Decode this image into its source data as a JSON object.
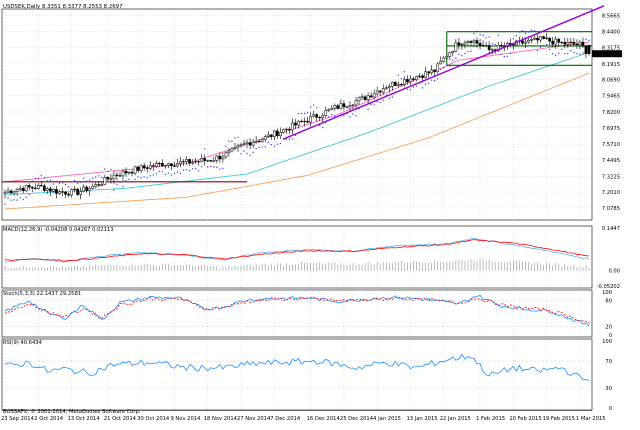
{
  "header": {
    "symbol_line": "USDSEK,Daily  8.3351 8.3377 8.2553 8.2697",
    "copyright": "BOSSAFX, © 2001-2014, MetaQuotes Software Corp."
  },
  "colors": {
    "up_candle": "#ffffff",
    "down_candle": "#000000",
    "trendline": "#9400d3",
    "channel": "#006400",
    "ma_fast": "#ff69b4",
    "ma_mid": "#40c8d8",
    "ma_slow": "#f4a460",
    "sar": "#3c3cff",
    "resistance": "#8b0000",
    "macd_line": "#5ab4f0",
    "macd_signal": "#ff0000",
    "macd_hist": "#a0a0a0",
    "stoch_k": "#1e90ff",
    "stoch_d": "#ff0000",
    "rsi": "#1e90ff"
  },
  "chart_data": [
    {
      "type": "candlestick",
      "pane": "price",
      "title": "USDSEK,Daily  8.3351 8.3377 8.2553 8.2697",
      "symbol": "USDSEK",
      "timeframe": "Daily",
      "last_bar": {
        "open": 8.3351,
        "high": 8.3377,
        "low": 8.2553,
        "close": 8.2697
      },
      "current_price_label": "8.2697",
      "ylim": [
        7.0,
        8.6
      ],
      "y_ticks": [
        "8.5665",
        "8.4400",
        "8.3175",
        "8.1915",
        "8.0690",
        "7.9465",
        "7.8200",
        "7.6975",
        "7.5710",
        "7.4495",
        "7.3225",
        "7.2010",
        "7.0785"
      ],
      "x_ticks": [
        "23 Sep 2014",
        "2 Oct 2014",
        "13 Oct 2014",
        "21 Oct 2014",
        "30 Oct 2014",
        "9 Nov 2014",
        "18 Nov 2014",
        "27 Nov 2014",
        "7 Dec 2014",
        "16 Dec 2014",
        "25 Dec 2014",
        "4 Jan 2015",
        "13 Jan 2015",
        "22 Jan 2015",
        "1 Feb 2015",
        "10 Feb 2015",
        "19 Feb 2015",
        "1 Mar 2015"
      ],
      "close_anchors": [
        [
          0,
          7.2
        ],
        [
          5,
          7.23
        ],
        [
          12,
          7.24
        ],
        [
          18,
          7.2
        ],
        [
          24,
          7.2
        ],
        [
          30,
          7.25
        ],
        [
          36,
          7.33
        ],
        [
          44,
          7.38
        ],
        [
          52,
          7.42
        ],
        [
          60,
          7.43
        ],
        [
          68,
          7.45
        ],
        [
          74,
          7.5
        ],
        [
          80,
          7.58
        ],
        [
          86,
          7.62
        ],
        [
          92,
          7.68
        ],
        [
          100,
          7.76
        ],
        [
          104,
          7.8
        ],
        [
          110,
          7.86
        ],
        [
          118,
          7.92
        ],
        [
          126,
          8.02
        ],
        [
          134,
          8.08
        ],
        [
          142,
          8.14
        ],
        [
          146,
          8.26
        ],
        [
          150,
          8.36
        ],
        [
          154,
          8.38
        ],
        [
          160,
          8.3
        ],
        [
          166,
          8.33
        ],
        [
          172,
          8.36
        ],
        [
          178,
          8.38
        ],
        [
          184,
          8.35
        ],
        [
          190,
          8.34
        ],
        [
          193,
          8.27
        ]
      ],
      "horizontal_levels": {
        "resistance": 7.28,
        "channel_top": 8.44,
        "channel_mid": 8.33,
        "channel_bottom": 8.18
      },
      "purple_trendline": {
        "from": [
          92,
          7.61
        ],
        "to": [
          198,
          8.64
        ]
      },
      "moving_averages": {
        "fast": [
          [
            0,
            7.28
          ],
          [
            60,
            7.42
          ],
          [
            110,
            7.8
          ],
          [
            150,
            8.22
          ],
          [
            193,
            8.36
          ]
        ],
        "mid": [
          [
            0,
            7.18
          ],
          [
            40,
            7.23
          ],
          [
            80,
            7.34
          ],
          [
            120,
            7.66
          ],
          [
            160,
            8.02
          ],
          [
            193,
            8.28
          ]
        ],
        "slow": [
          [
            0,
            7.07
          ],
          [
            60,
            7.16
          ],
          [
            100,
            7.33
          ],
          [
            140,
            7.62
          ],
          [
            193,
            8.12
          ]
        ]
      }
    },
    {
      "type": "line",
      "pane": "macd",
      "title": "MACD(12,26,9) -0.04208 0.04267 0.02113",
      "y_ticks": [
        "0.1447",
        "0.00",
        "-0.05202"
      ],
      "ylim": [
        -0.052,
        0.145
      ],
      "series": [
        {
          "name": "MACD",
          "anchors": [
            [
              0,
              0.03
            ],
            [
              10,
              0.042
            ],
            [
              20,
              0.03
            ],
            [
              30,
              0.048
            ],
            [
              45,
              0.062
            ],
            [
              60,
              0.052
            ],
            [
              72,
              0.036
            ],
            [
              85,
              0.062
            ],
            [
              100,
              0.072
            ],
            [
              115,
              0.066
            ],
            [
              130,
              0.086
            ],
            [
              145,
              0.09
            ],
            [
              155,
              0.11
            ],
            [
              168,
              0.088
            ],
            [
              180,
              0.066
            ],
            [
              190,
              0.045
            ],
            [
              193,
              0.04
            ]
          ]
        },
        {
          "name": "Signal",
          "anchors": [
            [
              0,
              0.036
            ],
            [
              10,
              0.04
            ],
            [
              20,
              0.034
            ],
            [
              30,
              0.042
            ],
            [
              45,
              0.058
            ],
            [
              60,
              0.054
            ],
            [
              72,
              0.04
            ],
            [
              85,
              0.056
            ],
            [
              100,
              0.068
            ],
            [
              115,
              0.066
            ],
            [
              130,
              0.08
            ],
            [
              145,
              0.088
            ],
            [
              155,
              0.104
            ],
            [
              168,
              0.094
            ],
            [
              180,
              0.074
            ],
            [
              190,
              0.054
            ],
            [
              193,
              0.048
            ]
          ]
        }
      ]
    },
    {
      "type": "line",
      "pane": "stochastic",
      "title": "Stoch(5,3,3) 22.1437 29.2581",
      "y_ticks": [
        "100",
        "80",
        "20",
        "0"
      ],
      "ylim": [
        0,
        100
      ],
      "series": [
        {
          "name": "%K",
          "anchors": [
            [
              0,
              55
            ],
            [
              8,
              80
            ],
            [
              14,
              50
            ],
            [
              20,
              40
            ],
            [
              26,
              70
            ],
            [
              32,
              35
            ],
            [
              38,
              75
            ],
            [
              48,
              88
            ],
            [
              58,
              85
            ],
            [
              66,
              60
            ],
            [
              72,
              65
            ],
            [
              80,
              82
            ],
            [
              90,
              85
            ],
            [
              100,
              86
            ],
            [
              110,
              78
            ],
            [
              120,
              84
            ],
            [
              130,
              88
            ],
            [
              140,
              82
            ],
            [
              150,
              72
            ],
            [
              156,
              92
            ],
            [
              164,
              68
            ],
            [
              172,
              60
            ],
            [
              180,
              56
            ],
            [
              188,
              35
            ],
            [
              193,
              22
            ]
          ]
        },
        {
          "name": "%D",
          "anchors": [
            [
              0,
              52
            ],
            [
              8,
              72
            ],
            [
              14,
              54
            ],
            [
              20,
              42
            ],
            [
              26,
              62
            ],
            [
              32,
              40
            ],
            [
              38,
              70
            ],
            [
              48,
              84
            ],
            [
              58,
              84
            ],
            [
              66,
              62
            ],
            [
              72,
              64
            ],
            [
              80,
              78
            ],
            [
              90,
              84
            ],
            [
              100,
              84
            ],
            [
              110,
              80
            ],
            [
              120,
              82
            ],
            [
              130,
              86
            ],
            [
              140,
              82
            ],
            [
              150,
              74
            ],
            [
              156,
              86
            ],
            [
              164,
              70
            ],
            [
              172,
              62
            ],
            [
              180,
              58
            ],
            [
              188,
              40
            ],
            [
              193,
              29
            ]
          ]
        }
      ]
    },
    {
      "type": "line",
      "pane": "rsi",
      "title": "RSI(9) 40.6434",
      "y_ticks": [
        "100",
        "70",
        "30",
        "0"
      ],
      "ylim": [
        0,
        100
      ],
      "series": [
        {
          "name": "RSI",
          "anchors": [
            [
              0,
              62
            ],
            [
              8,
              68
            ],
            [
              14,
              55
            ],
            [
              20,
              58
            ],
            [
              28,
              52
            ],
            [
              36,
              65
            ],
            [
              48,
              68
            ],
            [
              60,
              60
            ],
            [
              72,
              60
            ],
            [
              82,
              66
            ],
            [
              92,
              68
            ],
            [
              104,
              70
            ],
            [
              116,
              60
            ],
            [
              126,
              68
            ],
            [
              136,
              60
            ],
            [
              146,
              72
            ],
            [
              154,
              78
            ],
            [
              160,
              48
            ],
            [
              168,
              60
            ],
            [
              176,
              55
            ],
            [
              184,
              60
            ],
            [
              190,
              45
            ],
            [
              193,
              40.64
            ]
          ]
        }
      ]
    }
  ]
}
